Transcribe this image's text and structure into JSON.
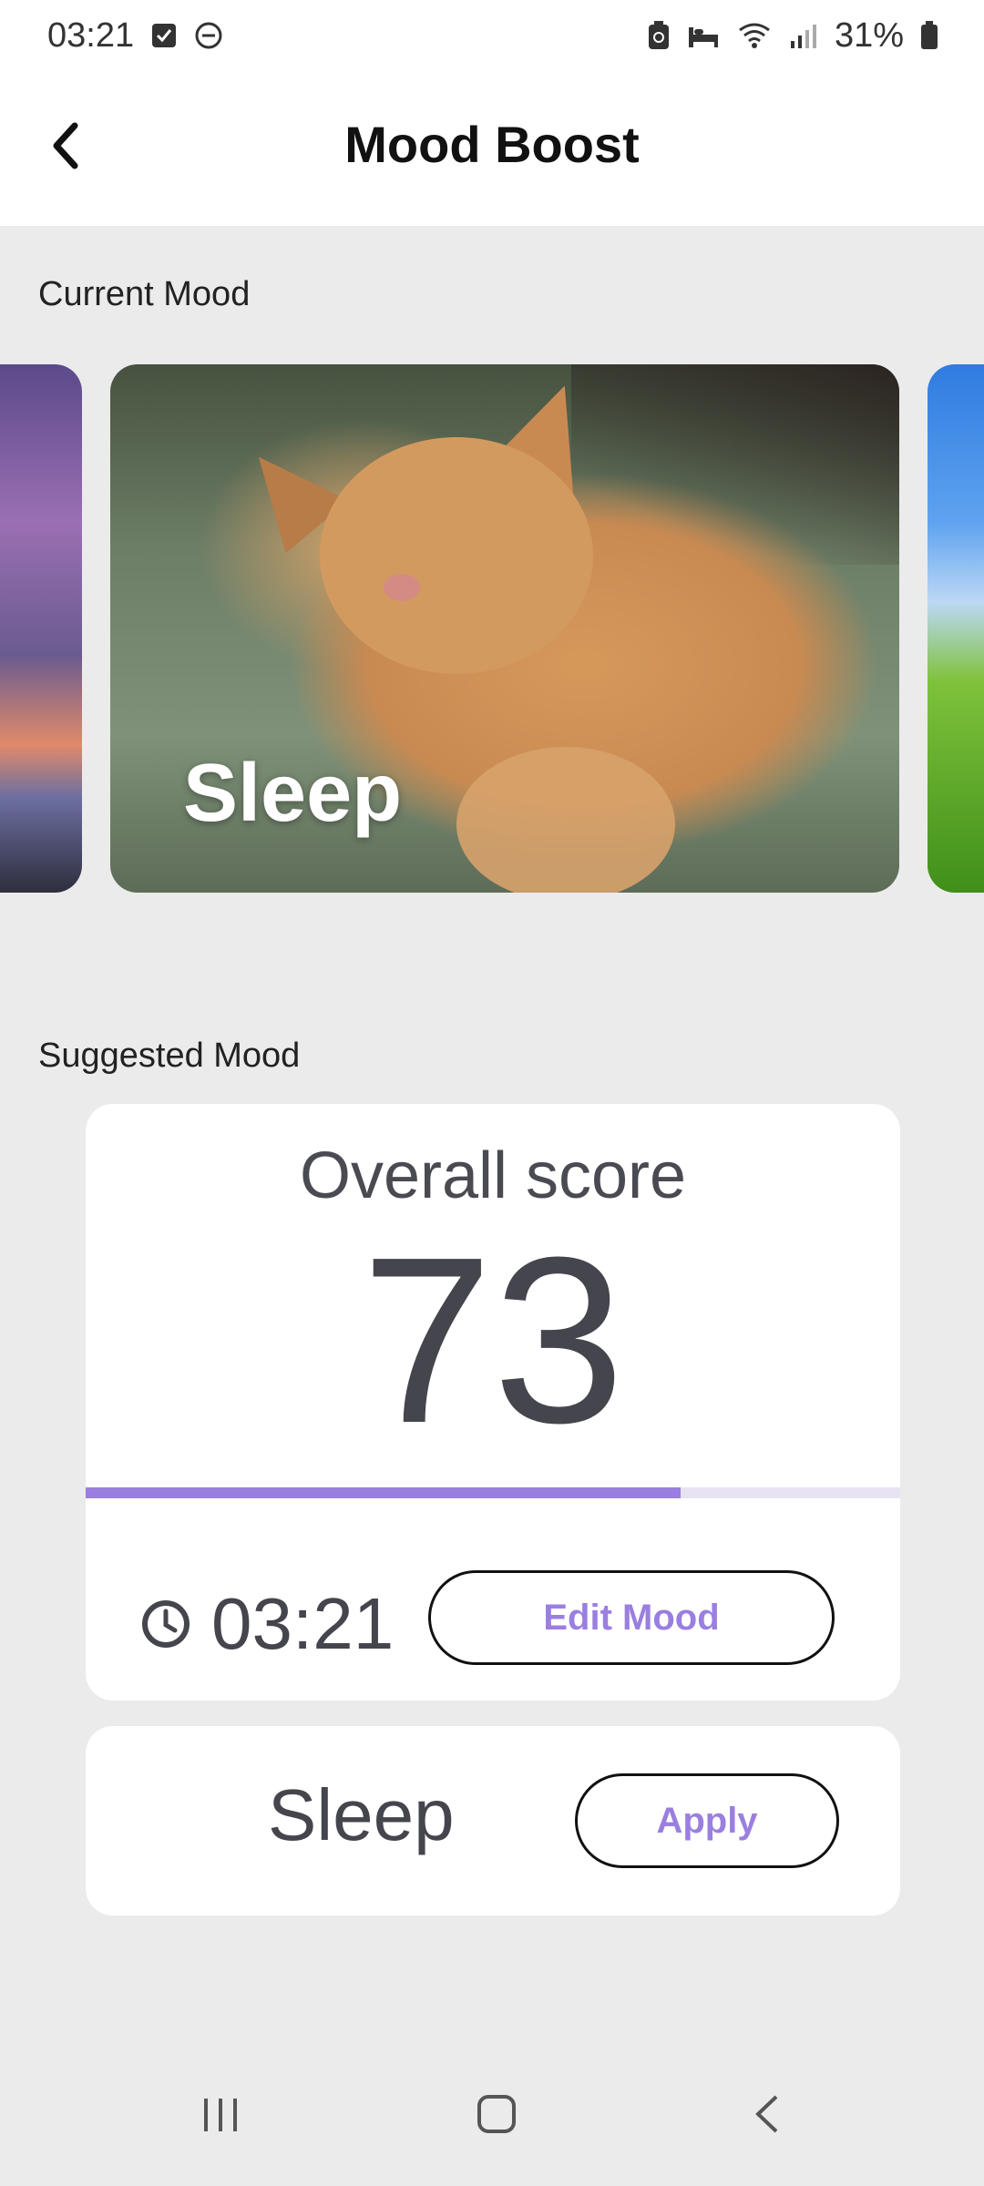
{
  "status_bar": {
    "time": "03:21",
    "battery": "31%",
    "icons": [
      "task-done-icon",
      "do-not-disturb-icon",
      "battery-saver-icon",
      "sleep-icon",
      "wifi-icon",
      "signal-icon",
      "battery-icon"
    ]
  },
  "app_bar": {
    "title": "Mood Boost",
    "back_icon": "back-arrow-icon"
  },
  "current_mood": {
    "label": "Current Mood",
    "cards": [
      {
        "label": "",
        "image": "sunset-pier"
      },
      {
        "label": "Sleep",
        "image": "sleeping-cat"
      },
      {
        "label": "",
        "image": "green-hill-sky"
      }
    ]
  },
  "suggested_mood": {
    "label": "Suggested Mood",
    "score_title": "Overall score",
    "score_value": "73",
    "score_progress": 0.73,
    "time": "03:21",
    "edit_button": "Edit Mood",
    "suggestion": "Sleep",
    "apply_button": "Apply"
  },
  "colors": {
    "accent": "#9a7fe0",
    "background": "#ebebeb",
    "card": "#ffffff",
    "text_dark": "#45454d"
  },
  "nav_bar": {
    "icons": [
      "recents-icon",
      "home-icon",
      "back-icon"
    ]
  }
}
